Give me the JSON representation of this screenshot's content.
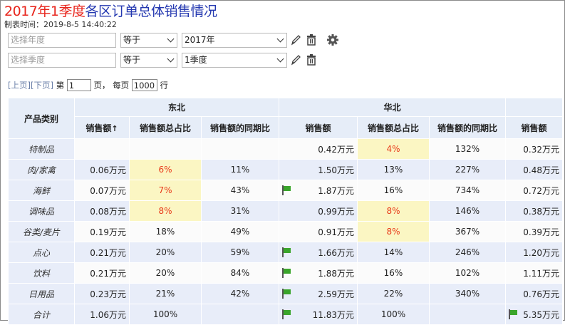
{
  "title": {
    "highlight": "2017年1季度",
    "rest": "各区订单总体销售情况"
  },
  "subtitle": "制表时间：2019-8-5 14:40:22",
  "filters": [
    {
      "name_placeholder": "选择年度",
      "operator": "等于",
      "value": "2017年",
      "show_settings": true
    },
    {
      "name_placeholder": "选择季度",
      "operator": "等于",
      "value": "1季度",
      "show_settings": false
    }
  ],
  "pager": {
    "prev": "[上页]",
    "next": "[下页]",
    "page_prefix": "第",
    "page_value": "1",
    "page_suffix": "页，",
    "per_page_prefix": "每页",
    "per_page_value": "1000",
    "per_page_suffix": "行"
  },
  "table": {
    "category_header": "产品类别",
    "regions": [
      "东北",
      "华北"
    ],
    "columns": {
      "ne_sales": "销售额",
      "sort_arrow": "↑",
      "ne_share": "销售额总占比",
      "ne_yoy": "销售额的同期比",
      "nc_sales": "销售额",
      "nc_share": "销售额总占比",
      "nc_yoy": "销售额的同期比",
      "other_sales": "销售额"
    },
    "rows": [
      {
        "cat": "特制品",
        "ne_sales": "",
        "ne_share": "",
        "ne_yoy": "",
        "nc_flag": false,
        "nc_sales": "0.42万元",
        "nc_share": "4%",
        "nc_share_hl": true,
        "nc_yoy": "132%",
        "o_flag": false,
        "o_sales": "0.32万元"
      },
      {
        "cat": "肉/家禽",
        "ne_sales": "0.06万元",
        "ne_share": "6%",
        "ne_share_hl": true,
        "ne_yoy": "11%",
        "nc_flag": false,
        "nc_sales": "1.50万元",
        "nc_share": "13%",
        "nc_share_hl": false,
        "nc_yoy": "227%",
        "o_flag": false,
        "o_sales": "0.48万元"
      },
      {
        "cat": "海鲜",
        "ne_sales": "0.07万元",
        "ne_share": "7%",
        "ne_share_hl": true,
        "ne_yoy": "43%",
        "nc_flag": true,
        "nc_sales": "1.87万元",
        "nc_share": "16%",
        "nc_share_hl": false,
        "nc_yoy": "734%",
        "o_flag": false,
        "o_sales": "0.72万元"
      },
      {
        "cat": "调味品",
        "ne_sales": "0.08万元",
        "ne_share": "8%",
        "ne_share_hl": true,
        "ne_yoy": "31%",
        "nc_flag": false,
        "nc_sales": "0.99万元",
        "nc_share": "8%",
        "nc_share_hl": true,
        "nc_yoy": "146%",
        "o_flag": false,
        "o_sales": "0.38万元"
      },
      {
        "cat": "谷类/麦片",
        "ne_sales": "0.19万元",
        "ne_share": "18%",
        "ne_share_hl": false,
        "ne_yoy": "49%",
        "nc_flag": false,
        "nc_sales": "0.91万元",
        "nc_share": "8%",
        "nc_share_hl": true,
        "nc_yoy": "367%",
        "o_flag": false,
        "o_sales": "0.39万元"
      },
      {
        "cat": "点心",
        "ne_sales": "0.21万元",
        "ne_share": "20%",
        "ne_share_hl": false,
        "ne_yoy": "59%",
        "nc_flag": true,
        "nc_sales": "1.66万元",
        "nc_share": "14%",
        "nc_share_hl": false,
        "nc_yoy": "246%",
        "o_flag": false,
        "o_sales": "1.20万元"
      },
      {
        "cat": "饮料",
        "ne_sales": "0.21万元",
        "ne_share": "20%",
        "ne_share_hl": false,
        "ne_yoy": "84%",
        "nc_flag": true,
        "nc_sales": "1.88万元",
        "nc_share": "16%",
        "nc_share_hl": false,
        "nc_yoy": "102%",
        "o_flag": false,
        "o_sales": "1.11万元"
      },
      {
        "cat": "日用品",
        "ne_sales": "0.23万元",
        "ne_share": "21%",
        "ne_share_hl": false,
        "ne_yoy": "42%",
        "nc_flag": true,
        "nc_sales": "2.59万元",
        "nc_share": "22%",
        "nc_share_hl": false,
        "nc_yoy": "340%",
        "o_flag": false,
        "o_sales": "0.76万元"
      },
      {
        "cat": "合计",
        "ne_sales": "1.06万元",
        "ne_share": "100%",
        "ne_share_hl": false,
        "ne_yoy": "",
        "nc_flag": true,
        "nc_sales": "11.83万元",
        "nc_share": "100%",
        "nc_share_hl": false,
        "nc_yoy": "",
        "o_flag": true,
        "o_sales": "5.35万元"
      }
    ]
  },
  "colors": {
    "title_highlight": "#e8251c",
    "title_rest": "#2438b0",
    "header_bg": "#e6edf8",
    "highlight_cell_bg": "#fbf6c3",
    "highlight_text": "#e83a1a",
    "flag_green": "#3aa52b"
  },
  "icons": [
    "pencil-icon",
    "trash-icon",
    "gear-icon",
    "green-flag-icon",
    "chevron-down-icon"
  ]
}
